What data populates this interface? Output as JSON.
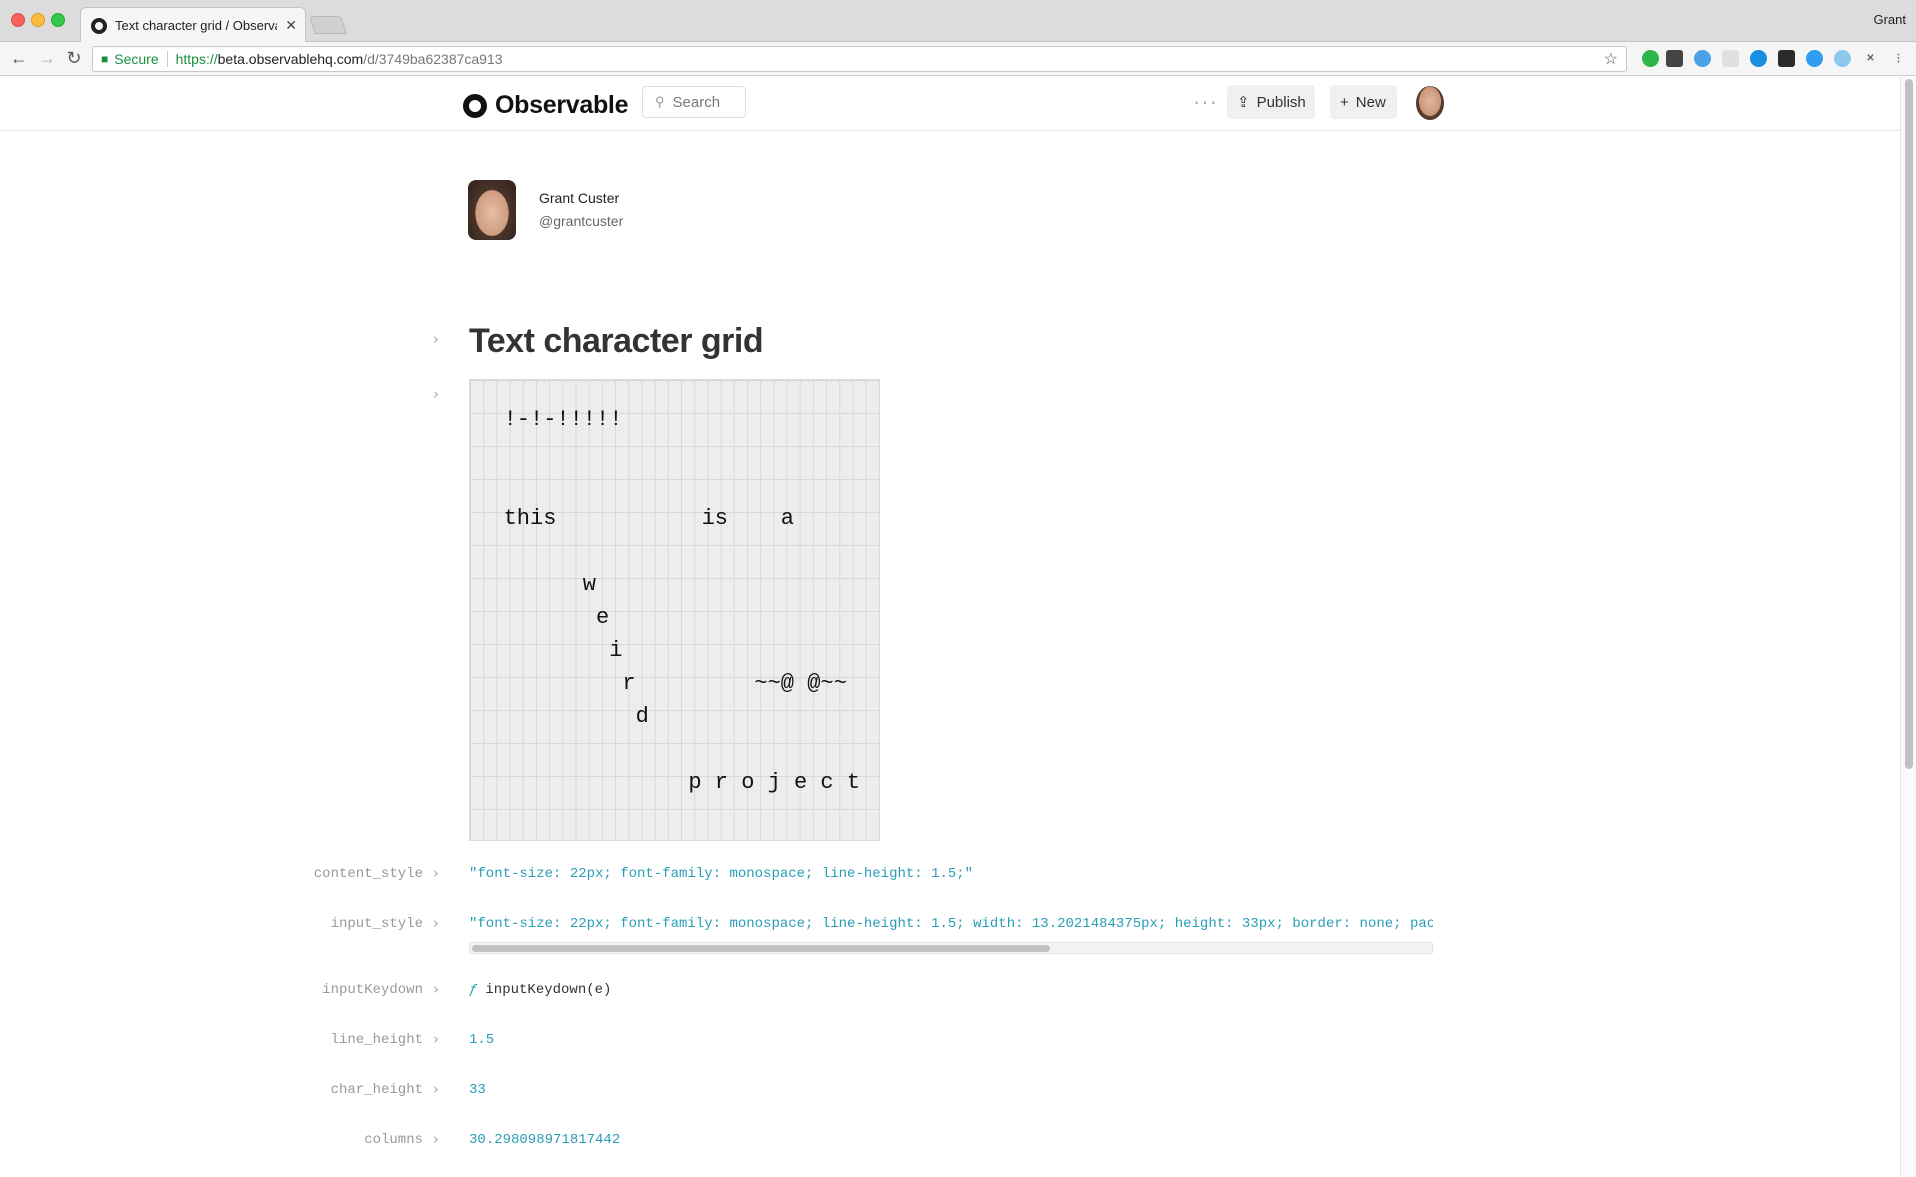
{
  "browser": {
    "tab_title": "Text character grid / Observable",
    "profile_name": "Grant",
    "secure_label": "Secure",
    "url_protocol": "https://",
    "url_host": "beta.observablehq.com",
    "url_path": "/d/3749ba62387ca913"
  },
  "header": {
    "brand": "Observable",
    "search_placeholder": "Search",
    "publish_label": "Publish",
    "new_label": "New"
  },
  "author": {
    "name": "Grant Custer",
    "handle": "@grantcuster"
  },
  "notebook": {
    "title": "Text character grid",
    "grid_lines": [
      {
        "text": "!-!-!!!!!",
        "col": 3,
        "row": 1
      },
      {
        "text": "this",
        "col": 3,
        "row": 4
      },
      {
        "text": "is",
        "col": 18,
        "row": 4
      },
      {
        "text": "a",
        "col": 24,
        "row": 4
      },
      {
        "text": "w",
        "col": 9,
        "row": 6
      },
      {
        "text": "e",
        "col": 10,
        "row": 7
      },
      {
        "text": "i",
        "col": 11,
        "row": 8
      },
      {
        "text": "r",
        "col": 12,
        "row": 9
      },
      {
        "text": "~~@ @~~",
        "col": 22,
        "row": 9
      },
      {
        "text": "d",
        "col": 13,
        "row": 10
      },
      {
        "text": "p r o j e c t",
        "col": 17,
        "row": 12
      }
    ],
    "cells": {
      "content_style": {
        "label": "content_style",
        "value": "\"font-size: 22px; font-family: monospace; line-height: 1.5;\""
      },
      "input_style": {
        "label": "input_style",
        "value": "\"font-size: 22px; font-family: monospace; line-height: 1.5; width: 13.2021484375px; height: 33px; border: none; pac"
      },
      "inputKeydown": {
        "label": "inputKeydown",
        "glyph": "ƒ",
        "value": "inputKeydown(e)"
      },
      "line_height": {
        "label": "line_height",
        "value": "1.5"
      },
      "char_height": {
        "label": "char_height",
        "value": "33"
      },
      "columns": {
        "label": "columns",
        "value": "30.298098971817442"
      }
    }
  }
}
